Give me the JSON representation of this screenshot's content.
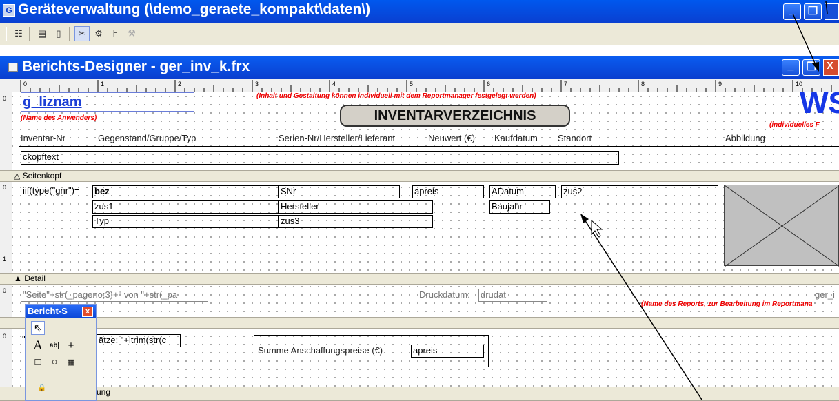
{
  "app": {
    "title": "Geräteverwaltung (\\demo_geraete_kompakt\\daten\\)",
    "icon": "G"
  },
  "toolbar": {
    "icons": [
      "list-icon",
      "network-icon",
      "document-icon",
      "tools-icon",
      "settings-icon",
      "align-icon",
      "disabled-icon"
    ]
  },
  "designer": {
    "title": "Berichts-Designer - ger_inv_k.frx"
  },
  "ruler": {
    "h_ticks": [
      "0",
      "1",
      "2",
      "3",
      "4",
      "5",
      "6",
      "7",
      "8",
      "9",
      "10"
    ],
    "v_ticks": [
      "0",
      "0",
      "1",
      "0",
      "0"
    ]
  },
  "header_section": {
    "field_liznam": "g_liznam",
    "note_user": "(Name des Anwenders)",
    "note_top": "(Inhalt und Gestaltung können individuell mit dem Reportmanager festgelegt werden)",
    "title_box": "INVENTARVERZEICHNIS",
    "logo": "WS",
    "note_logo": "(individuelles F",
    "col_inventar": "Inventar-Nr",
    "col_gegenstand": "Gegenstand/Gruppe/Typ",
    "col_serien": "Serien-Nr/Hersteller/Lieferant",
    "col_neuwert": "Neuwert (€)",
    "col_kaufdatum": "Kaufdatum",
    "col_standort": "Standort",
    "col_abbildung": "Abbildung",
    "field_ckopftext": "ckopftext"
  },
  "bands": {
    "seitenkopf": "Seitenkopf",
    "detail": "Detail",
    "summary": "ung"
  },
  "detail_section": {
    "iif": "iif(type(\"gnr\")=",
    "bez": "bez",
    "zus1": "zus1",
    "typ": "Typ",
    "snr": "SNr",
    "hersteller": "Hersteller",
    "zus3": "zus3",
    "apreis": "apreis",
    "adatum": "ADatum",
    "baujahr": "Baujahr",
    "zus2": "zus2"
  },
  "footer_section": {
    "seite": "\"Seite\"+str(_pageno;3)+\" von \"+str(_pa",
    "druckdatum_label": "Druckdatum:",
    "druckdatum": "drudat",
    "ger": "ger_i",
    "note_report": "(Name des Reports, zur Bearbeitung im Reportmana"
  },
  "summary_section": {
    "saetze": "ätze: \"+ltrim(str(c",
    "summe": "Summe Anschaffungspreise (€)",
    "apreis": "apreis",
    "quote": "\""
  },
  "palette": {
    "title": "Bericht-S",
    "close": "x"
  }
}
